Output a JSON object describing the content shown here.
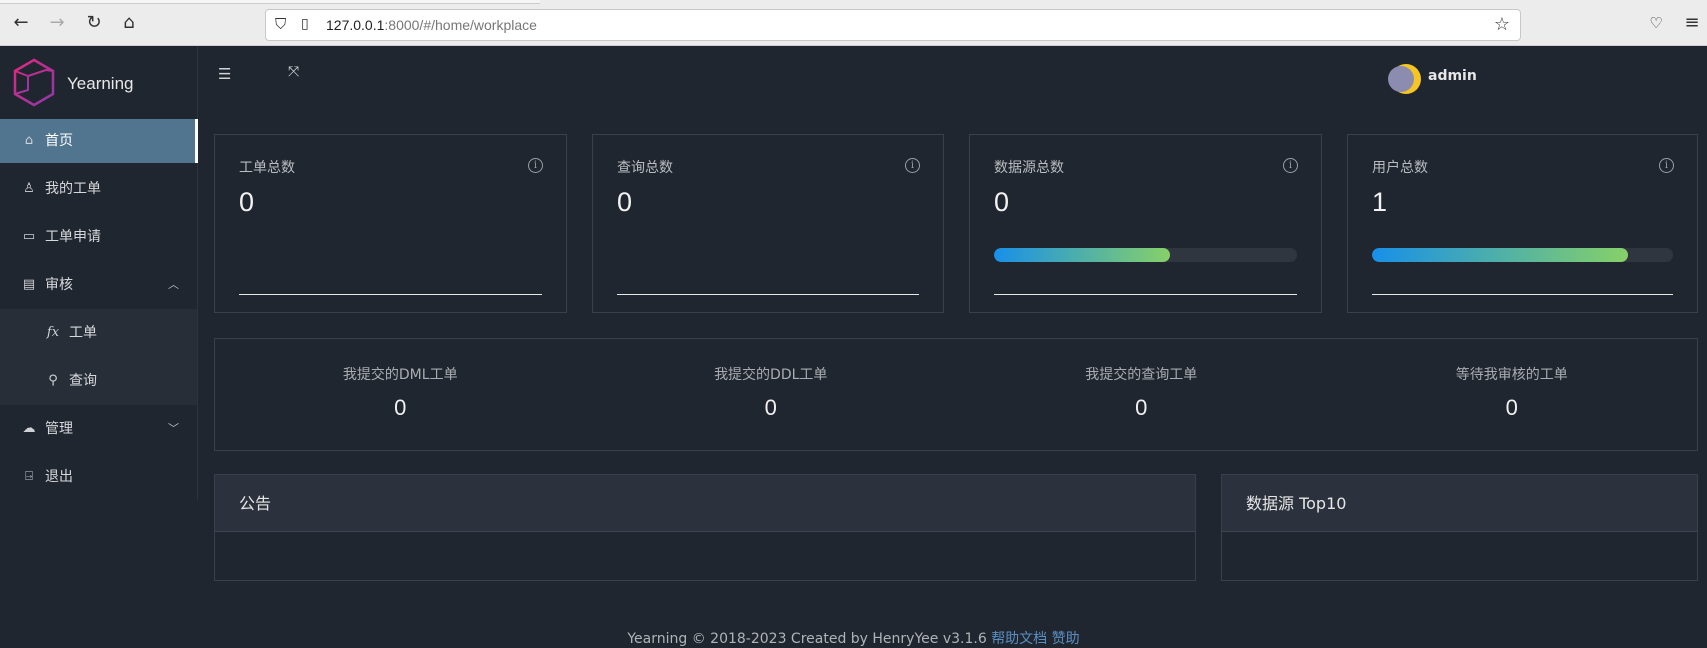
{
  "browser": {
    "url_host": "127.0.0.1",
    "url_rest": ":8000/#/home/workplace"
  },
  "app": {
    "name": "Yearning",
    "user": "admin"
  },
  "sidebar": {
    "items": [
      {
        "label": "首页",
        "icon": "home-icon"
      },
      {
        "label": "我的工单",
        "icon": "user-icon"
      },
      {
        "label": "工单申请",
        "icon": "monitor-icon"
      },
      {
        "label": "审核",
        "icon": "audit-icon"
      },
      {
        "label": "工单",
        "icon": "fx-icon"
      },
      {
        "label": "查询",
        "icon": "search-icon"
      },
      {
        "label": "管理",
        "icon": "cloud-icon"
      },
      {
        "label": "退出",
        "icon": "logout-icon"
      }
    ]
  },
  "cards": [
    {
      "title": "工单总数",
      "value": "0"
    },
    {
      "title": "查询总数",
      "value": "0"
    },
    {
      "title": "数据源总数",
      "value": "0",
      "progress": 58
    },
    {
      "title": "用户总数",
      "value": "1",
      "progress": 85
    }
  ],
  "stats": [
    {
      "label": "我提交的DML工单",
      "value": "0"
    },
    {
      "label": "我提交的DDL工单",
      "value": "0"
    },
    {
      "label": "我提交的查询工单",
      "value": "0"
    },
    {
      "label": "等待我审核的工单",
      "value": "0"
    }
  ],
  "panels": {
    "notice": "公告",
    "top10": "数据源 Top10"
  },
  "footer": {
    "text": "Yearning © 2018-2023 Created by HenryYee v3.1.6",
    "help": "帮助文档",
    "sponsor": "赞助"
  },
  "colors": {
    "accent": "#51758f",
    "progress_start": "#1890e8",
    "progress_end": "#87d068"
  }
}
